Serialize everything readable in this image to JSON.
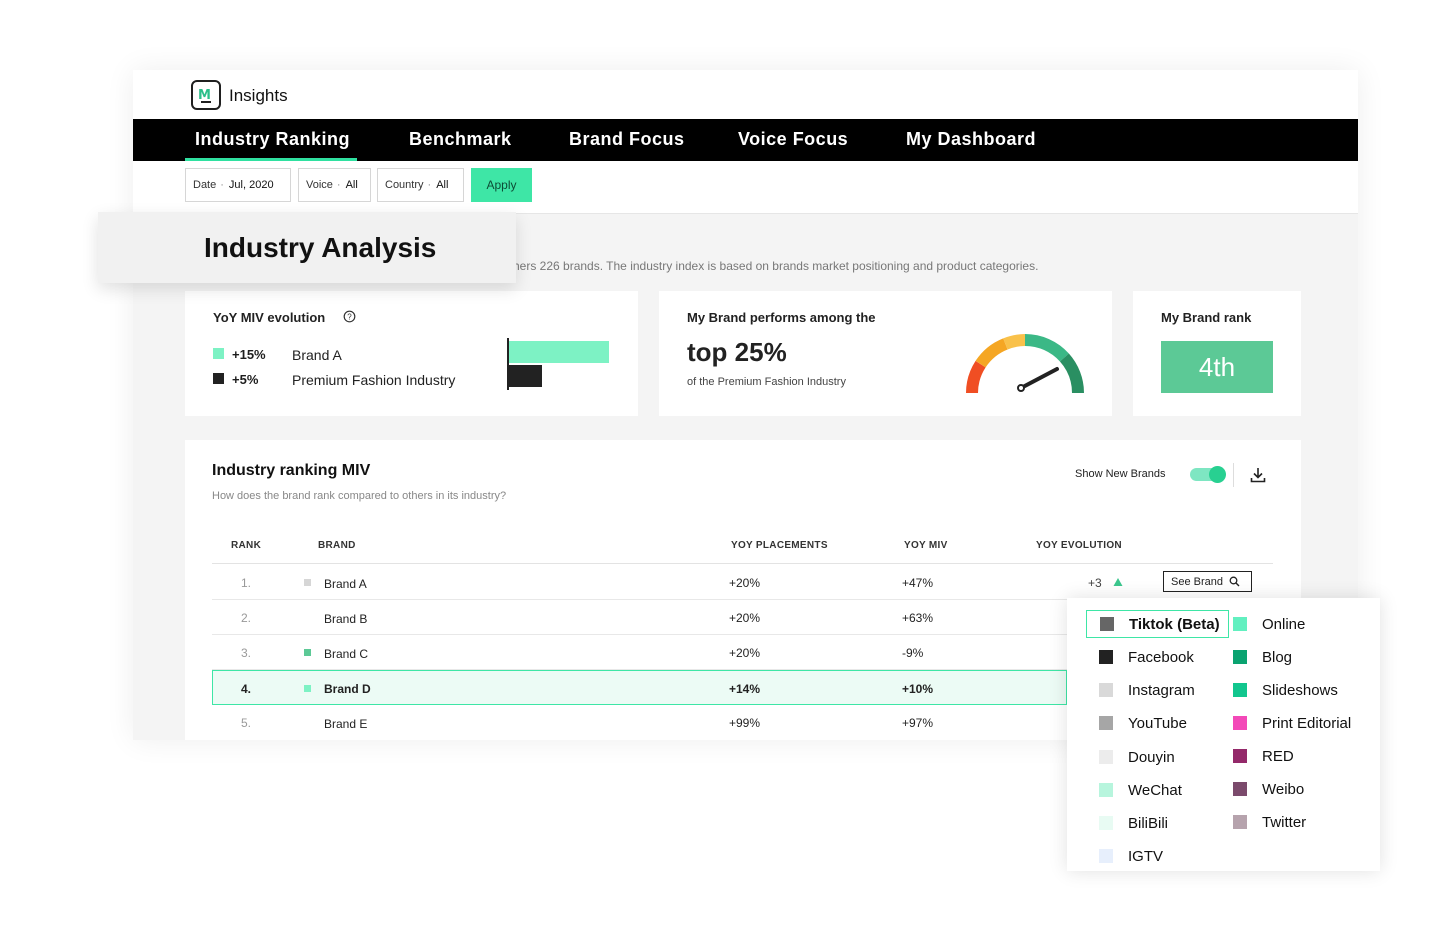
{
  "app": {
    "title": "Insights"
  },
  "nav": [
    {
      "label": "Industry Ranking",
      "active": true
    },
    {
      "label": "Benchmark"
    },
    {
      "label": "Brand Focus"
    },
    {
      "label": "Voice Focus"
    },
    {
      "label": "My Dashboard"
    }
  ],
  "filters": {
    "date": {
      "label": "Date",
      "value": "Jul, 2020"
    },
    "voice": {
      "label": "Voice",
      "value": "All"
    },
    "country": {
      "label": "Country",
      "value": "All"
    },
    "apply": "Apply",
    "separator": "·"
  },
  "page": {
    "title": "Industry Analysis",
    "description_visible": "hers 226 brands. The industry index is based on brands market positioning and product categories."
  },
  "miv_card": {
    "title": "YoY MIV evolution",
    "help_icon": "question-circle-icon",
    "items": [
      {
        "value": "+15%",
        "name": "Brand A",
        "color": "#7df2c4",
        "bar": 15
      },
      {
        "value": "+5%",
        "name": "Premium Fashion Industry",
        "color": "#222222",
        "bar": 5
      }
    ]
  },
  "perf_card": {
    "title": "My Brand performs among the",
    "highlight": "top 25%",
    "subtitle": "of the Premium Fashion Industry",
    "gauge_level": 0.75
  },
  "rank_card": {
    "title": "My Brand rank",
    "value": "4th",
    "color": "#5cc996"
  },
  "table": {
    "title": "Industry ranking MIV",
    "subtitle": "How does the brand rank compared to others in its industry?",
    "toggle_label": "Show New Brands",
    "toggle_on": true,
    "download_icon": "download-icon",
    "columns": [
      "RANK",
      "BRAND",
      "YOY PLACEMENTS",
      "YOY MIV",
      "YOY EVOLUTION"
    ],
    "rows": [
      {
        "rank": "1.",
        "brand": "Brand A",
        "placements": "+20%",
        "miv": "+47%",
        "evolution": "+3",
        "dot": "#d6d6d6"
      },
      {
        "rank": "2.",
        "brand": "Brand B",
        "placements": "+20%",
        "miv": "+63%",
        "evolution": "",
        "dot": ""
      },
      {
        "rank": "3.",
        "brand": "Brand C",
        "placements": "+20%",
        "miv": "-9%",
        "evolution": "",
        "dot": "#5cc996"
      },
      {
        "rank": "4.",
        "brand": "Brand D",
        "placements": "+14%",
        "miv": "+10%",
        "evolution": "",
        "dot": "#7df2c4",
        "highlight": true
      },
      {
        "rank": "5.",
        "brand": "Brand E",
        "placements": "+99%",
        "miv": "+97%",
        "evolution": "",
        "dot": ""
      }
    ],
    "see_brand": "See Brand",
    "up_color": "#3cc78e"
  },
  "voices": {
    "left": [
      {
        "label": "Tiktok (Beta)",
        "color": "#666666",
        "active": true
      },
      {
        "label": "Facebook",
        "color": "#222222"
      },
      {
        "label": "Instagram",
        "color": "#d9d9d9"
      },
      {
        "label": "YouTube",
        "color": "#a6a6a6"
      },
      {
        "label": "Douyin",
        "color": "#ececec"
      },
      {
        "label": "WeChat",
        "color": "#b7f5dd"
      },
      {
        "label": "BiliBili",
        "color": "#e8fbf3"
      },
      {
        "label": "IGTV",
        "color": "#e7effc"
      }
    ],
    "right": [
      {
        "label": "Online",
        "color": "#62f0c0"
      },
      {
        "label": "Blog",
        "color": "#0aa370"
      },
      {
        "label": "Slideshows",
        "color": "#12c68e"
      },
      {
        "label": "Print Editorial",
        "color": "#f349b8"
      },
      {
        "label": "RED",
        "color": "#94296a"
      },
      {
        "label": "Weibo",
        "color": "#7b4a6c"
      },
      {
        "label": "Twitter",
        "color": "#b6a3ad"
      }
    ]
  }
}
